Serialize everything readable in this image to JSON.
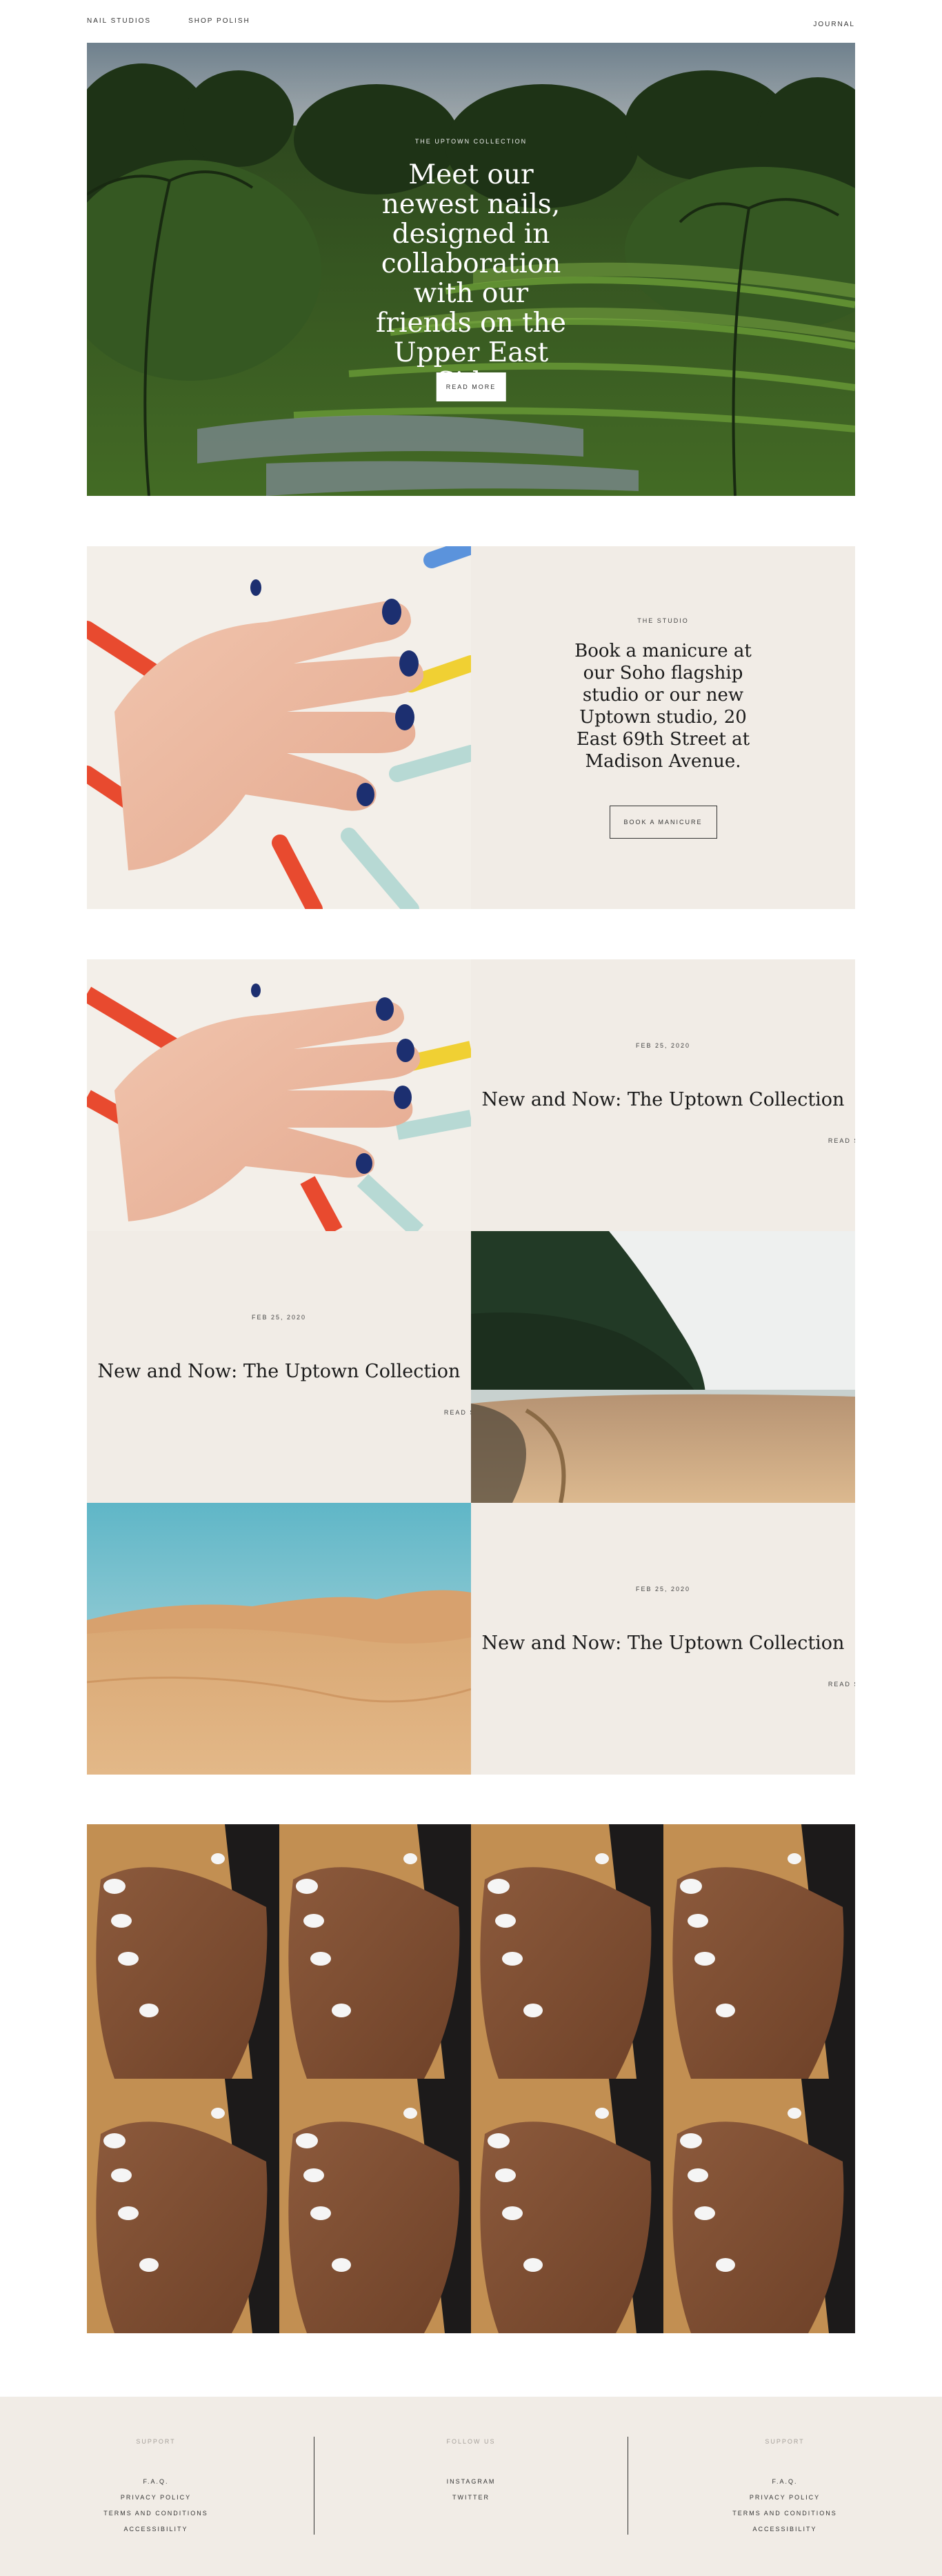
{
  "nav": {
    "brand": "NAIL STUDIOS",
    "shop": "SHOP POLISH",
    "journal": "JOURNAL"
  },
  "hero": {
    "eyebrow": "THE UPTOWN COLLECTION",
    "headline": "Meet our newest nails, designed in collaboration with our friends on the Upper East Side.",
    "button": "READ MORE"
  },
  "studio": {
    "eyebrow": "THE STUDIO",
    "body": "Book a manicure at our Soho flagship studio or our new Uptown studio, 20 East 69th Street at Madison Avenue.",
    "button": "BOOK A MANICURE"
  },
  "stories": [
    {
      "date": "FEB 25, 2020",
      "title": "New and Now: The Uptown Collection",
      "link": "READ STORY"
    },
    {
      "date": "FEB 25, 2020",
      "title": "New and Now: The Uptown Collection",
      "link": "READ STORY"
    },
    {
      "date": "FEB 25, 2020",
      "title": "New and Now: The Uptown Collection",
      "link": "READ STORY"
    }
  ],
  "footer": {
    "col1": {
      "heading": "SUPPORT",
      "links": [
        "F.A.Q.",
        "PRIVACY POLICY",
        "TERMS AND CONDITIONS",
        "ACCESSIBILITY"
      ]
    },
    "col2": {
      "heading": "FOLLOW US",
      "links": [
        "INSTAGRAM",
        "TWITTER"
      ]
    },
    "col3": {
      "heading": "SUPPORT",
      "links": [
        "F.A.Q.",
        "PRIVACY POLICY",
        "TERMS AND CONDITIONS",
        "ACCESSIBILITY"
      ]
    }
  },
  "colors": {
    "panel": "#f1ece6",
    "text": "#1a1a1a",
    "muted": "#a6a19b"
  }
}
